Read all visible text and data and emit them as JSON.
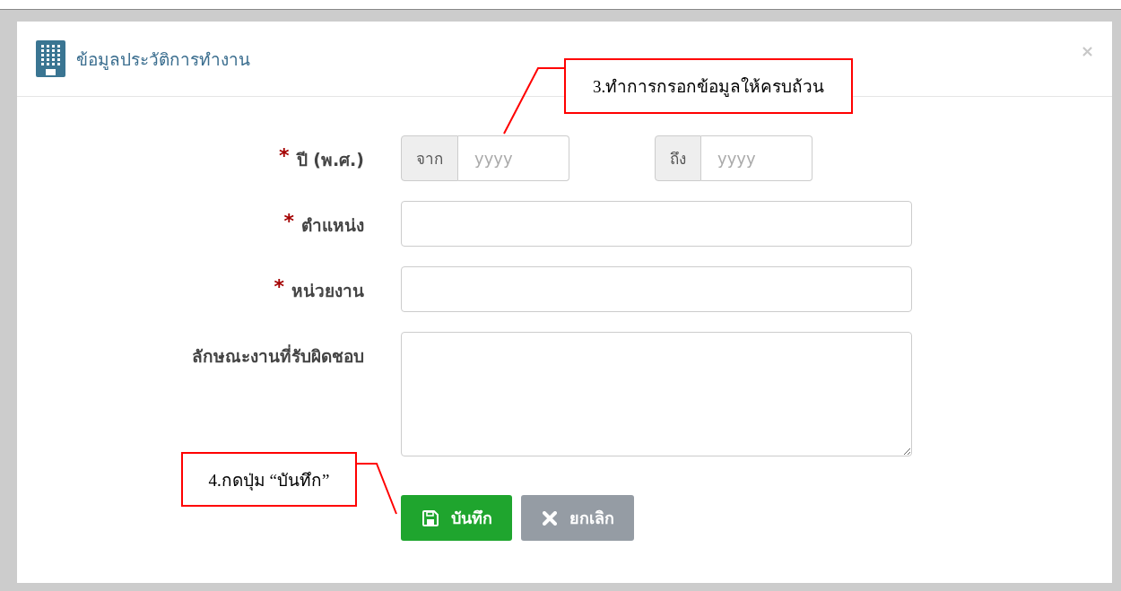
{
  "dialog": {
    "title": "ข้อมูลประวัติการทำงาน",
    "close_label": "×"
  },
  "fields": [
    {
      "kind": "range",
      "label": "ปี (พ.ศ.)",
      "required_mark": "*",
      "from_label": "จาก",
      "from_placeholder": "yyyy",
      "to_label": "ถึง",
      "to_placeholder": "yyyy"
    },
    {
      "kind": "text",
      "label": "ตำแหน่ง",
      "required_mark": "*"
    },
    {
      "kind": "text",
      "label": "หน่วยงาน",
      "required_mark": "*"
    },
    {
      "kind": "textarea",
      "label": "ลักษณะงานที่รับผิดชอบ"
    }
  ],
  "buttons": [
    {
      "kind": "save",
      "label": "บันทึก"
    },
    {
      "kind": "cancel",
      "label": "ยกเลิก"
    }
  ],
  "annotations": [
    {
      "text": "3.ทำการกรอกข้อมูลให้ครบถ้วน"
    },
    {
      "text": "4.กดปุ่ม “บันทึก”"
    }
  ]
}
